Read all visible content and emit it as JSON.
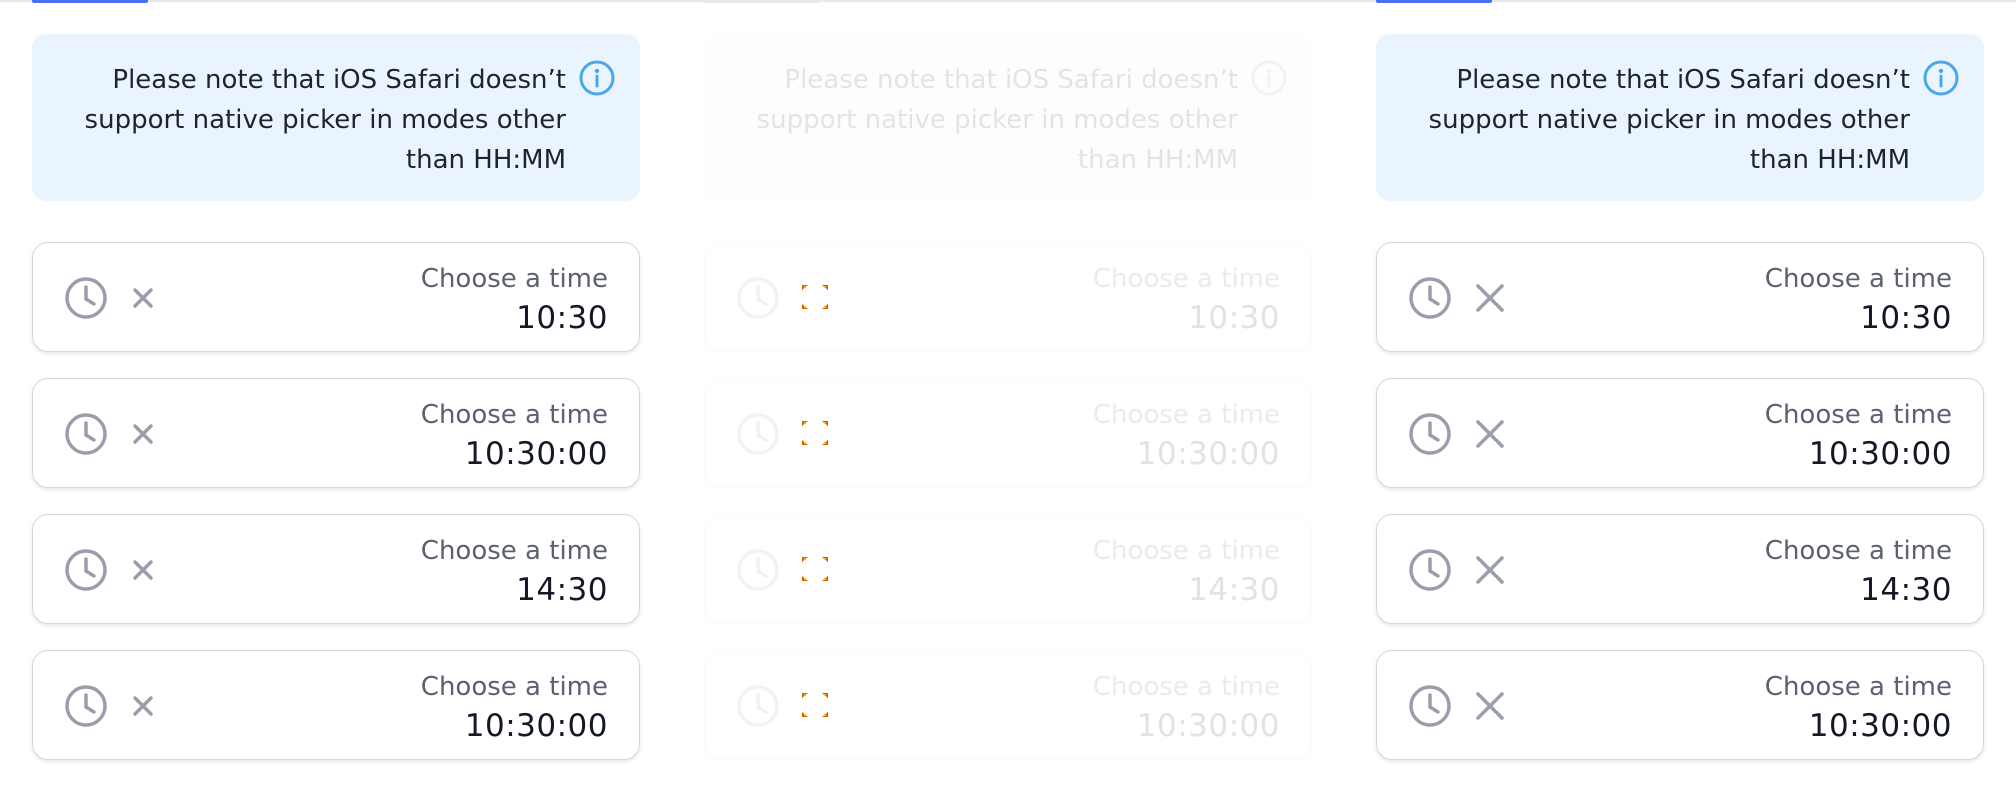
{
  "panels": [
    {
      "state": "default",
      "note": {
        "line1": "Please note that iOS Safari doesn’t",
        "line2": "support native picker in modes other",
        "line3": "than HH:MM"
      },
      "fields": [
        {
          "label": "Choose a time",
          "value": "10:30"
        },
        {
          "label": "Choose a time",
          "value": "10:30:00"
        },
        {
          "label": "Choose a time",
          "value": "14:30"
        },
        {
          "label": "Choose a time",
          "value": "10:30:00"
        }
      ]
    },
    {
      "state": "disabled",
      "note": {
        "line1": "Please note that iOS Safari doesn’t",
        "line2": "support native picker in modes other",
        "line3": "than HH:MM"
      },
      "fields": [
        {
          "label": "Choose a time",
          "value": "10:30"
        },
        {
          "label": "Choose a time",
          "value": "10:30:00"
        },
        {
          "label": "Choose a time",
          "value": "14:30"
        },
        {
          "label": "Choose a time",
          "value": "10:30:00"
        }
      ]
    },
    {
      "state": "large-clear-icon",
      "note": {
        "line1": "Please note that iOS Safari doesn’t",
        "line2": "support native picker in modes other",
        "line3": "than HH:MM"
      },
      "fields": [
        {
          "label": "Choose a time",
          "value": "10:30"
        },
        {
          "label": "Choose a time",
          "value": "10:30:00"
        },
        {
          "label": "Choose a time",
          "value": "14:30"
        },
        {
          "label": "Choose a time",
          "value": "10:30:00"
        }
      ]
    }
  ],
  "icons": {
    "note": "info-icon",
    "leading": "clock-icon",
    "trailing": "clear-icon",
    "disabled_trailing": "corner-marks-icon"
  },
  "colors": {
    "accent": "#4c6ef5",
    "info_icon": "#4aa8e8",
    "note_background": "#eaf4ff",
    "icon_gray": "#9a9eab",
    "text_primary": "#141826",
    "text_label": "#5c6070",
    "disabled_marks": "#e05a00"
  }
}
